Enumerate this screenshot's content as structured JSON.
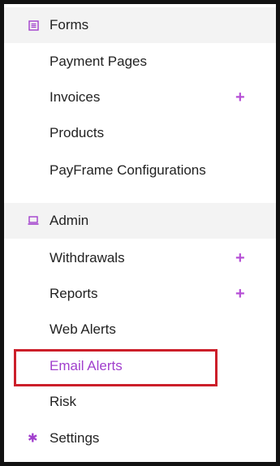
{
  "nav": {
    "forms": {
      "label": "Forms",
      "icon": "forms-icon",
      "items": [
        {
          "label": "Payment Pages",
          "has_plus": false
        },
        {
          "label": "Invoices",
          "has_plus": true
        },
        {
          "label": "Products",
          "has_plus": false
        },
        {
          "label": "PayFrame Configurations",
          "has_plus": false
        }
      ]
    },
    "admin": {
      "label": "Admin",
      "icon": "laptop-icon",
      "items": [
        {
          "label": "Withdrawals",
          "has_plus": true
        },
        {
          "label": "Reports",
          "has_plus": true
        },
        {
          "label": "Web Alerts",
          "has_plus": false
        },
        {
          "label": "Email Alerts",
          "has_plus": false,
          "active": true
        },
        {
          "label": "Risk",
          "has_plus": false
        }
      ]
    },
    "settings": {
      "label": "Settings",
      "icon": "gear-icon"
    },
    "plus_glyph": "+"
  },
  "colors": {
    "accent": "#a13fcd",
    "plus": "#b64fd6",
    "highlight": "#cc1f2a",
    "section_bg": "#f3f3f3",
    "border": "#111111"
  }
}
